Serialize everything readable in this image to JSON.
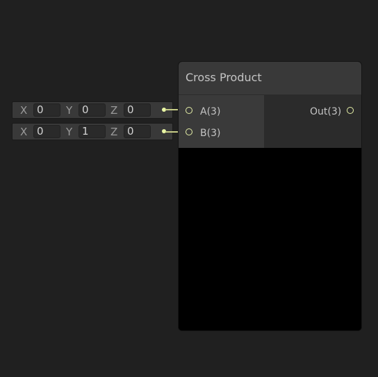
{
  "node": {
    "title": "Cross Product",
    "inputs": [
      {
        "label": "A(3)"
      },
      {
        "label": "B(3)"
      }
    ],
    "outputs": [
      {
        "label": "Out(3)"
      }
    ]
  },
  "inline_inputs": {
    "a": {
      "x_label": "X",
      "x_value": "0",
      "y_label": "Y",
      "y_value": "0",
      "z_label": "Z",
      "z_value": "0"
    },
    "b": {
      "x_label": "X",
      "x_value": "0",
      "y_label": "Y",
      "y_value": "1",
      "z_label": "Z",
      "z_value": "0"
    }
  },
  "colors": {
    "canvas_bg": "#202020",
    "port_accent": "#e6f0a8",
    "wire": "#c6cc86",
    "preview_bg": "#000000"
  }
}
